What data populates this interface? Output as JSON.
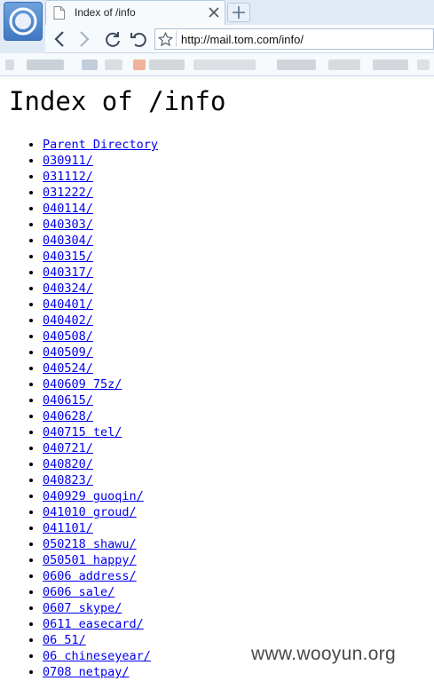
{
  "browser": {
    "tab_title": "Index of /info",
    "url": "http://mail.tom.com/info/",
    "icons": [
      "browser-logo-icon",
      "page-icon",
      "close-icon",
      "plus-icon",
      "back-icon",
      "forward-icon",
      "refresh-icon",
      "undo-icon",
      "star-icon"
    ]
  },
  "page": {
    "heading": "Index of /info",
    "entries": [
      "Parent Directory",
      "030911/",
      "031112/",
      "031222/",
      "040114/",
      "040303/",
      "040304/",
      "040315/",
      "040317/",
      "040324/",
      "040401/",
      "040402/",
      "040508/",
      "040509/",
      "040524/",
      "040609 75z/",
      "040615/",
      "040628/",
      "040715 tel/",
      "040721/",
      "040820/",
      "040823/",
      "040929 guoqin/",
      "041010 groud/",
      "041101/",
      "050218 shawu/",
      "050501 happy/",
      "0606 address/",
      "0606 sale/",
      "0607 skype/",
      "0611 easecard/",
      "06 51/",
      "06 chineseyear/",
      "0708 netpay/"
    ]
  },
  "watermark": "www.wooyun.org",
  "colors": {
    "link": "#0000ee",
    "chrome": "#dfeaf6"
  }
}
